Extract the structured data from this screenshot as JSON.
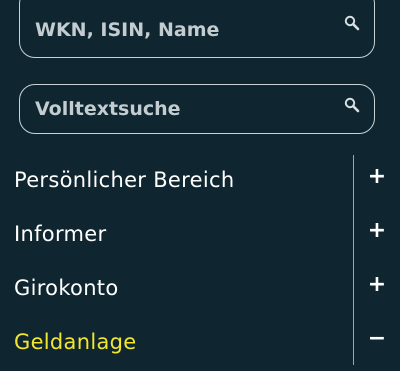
{
  "search": {
    "wkn_placeholder": "WKN, ISIN, Name",
    "fulltext_placeholder": "Volltextsuche",
    "icon": "search-icon"
  },
  "nav": {
    "items": [
      {
        "label": "Persönlicher Bereich",
        "toggle": "+",
        "active": false
      },
      {
        "label": "Informer",
        "toggle": "+",
        "active": false
      },
      {
        "label": "Girokonto",
        "toggle": "+",
        "active": false
      },
      {
        "label": "Geldanlage",
        "toggle": "−",
        "active": true
      }
    ]
  },
  "colors": {
    "background": "#0f2630",
    "active_text": "#f2e62f",
    "text": "#ffffff"
  }
}
